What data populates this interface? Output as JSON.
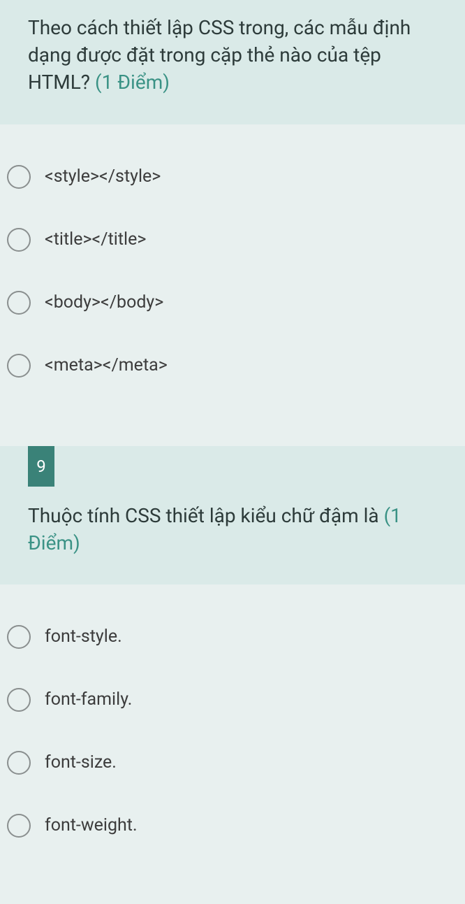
{
  "question1": {
    "text": "Theo cách thiết lập CSS trong, các mẫu định dạng được đặt trong cặp thẻ nào của tệp HTML? ",
    "points": "(1 Điểm)",
    "answers": [
      "<style></style>",
      "<title></title>",
      "<body></body>",
      "<meta></meta>"
    ]
  },
  "question2": {
    "number": "9",
    "text": "Thuộc tính CSS thiết lập kiểu chữ đậm là ",
    "points": "(1 Điểm)",
    "answers": [
      "font-style.",
      "font-family.",
      "font-size.",
      "font-weight."
    ]
  }
}
